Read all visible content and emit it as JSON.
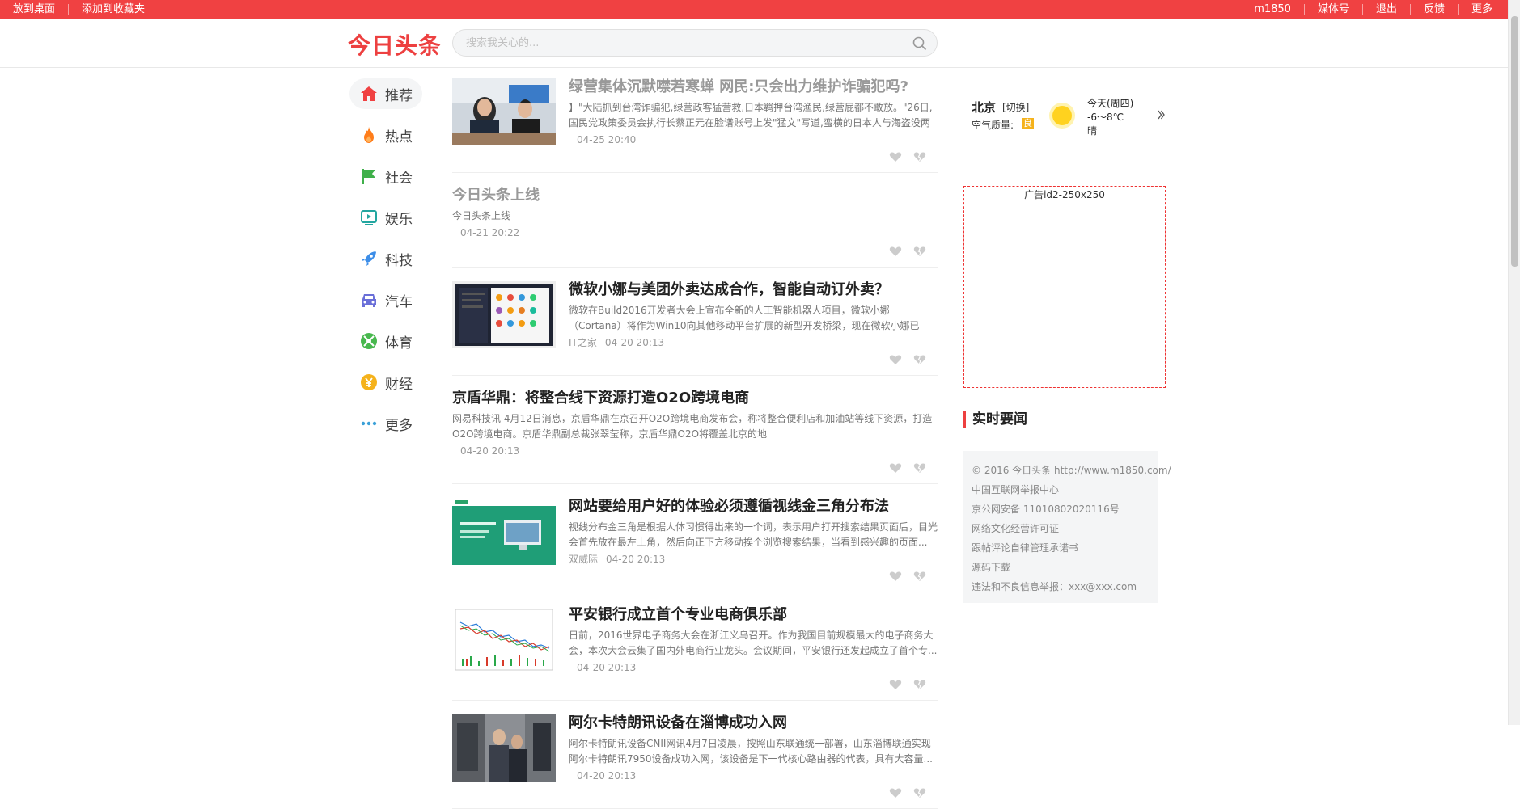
{
  "topbar": {
    "left": [
      "放到桌面",
      "添加到收藏夹"
    ],
    "right": [
      "m1850",
      "媒体号",
      "退出",
      "反馈",
      "更多"
    ]
  },
  "header": {
    "logo": "今日头条",
    "search_placeholder": "搜索我关心的..."
  },
  "nav": [
    {
      "label": "推荐",
      "icon": "home-icon",
      "color": "#f04142"
    },
    {
      "label": "热点",
      "icon": "fire-icon",
      "color": "#ff7d1a"
    },
    {
      "label": "社会",
      "icon": "flag-icon",
      "color": "#3fb04a"
    },
    {
      "label": "娱乐",
      "icon": "play-icon",
      "color": "#23a6a0"
    },
    {
      "label": "科技",
      "icon": "rocket-icon",
      "color": "#3d8ee8"
    },
    {
      "label": "汽车",
      "icon": "car-icon",
      "color": "#6a6fd8"
    },
    {
      "label": "体育",
      "icon": "sport-icon",
      "color": "#48b84e"
    },
    {
      "label": "财经",
      "icon": "money-icon",
      "color": "#f5b21b"
    },
    {
      "label": "更多",
      "icon": "more-icon",
      "color": "#3aa0d8"
    }
  ],
  "feed": [
    {
      "title": "绿营集体沉默噤若寒蝉 网民:只会出力维护诈骗犯吗?",
      "abstract": "】\"大陆抓到台湾诈骗犯,绿营政客猛营救,日本羁押台湾渔民,绿营屁都不敢放。\"26日,国民党政策委员会执行长蔡正元在脸谱账号上发\"猛文\"写道,蛮横的日本人与海盗没两样...",
      "source": "",
      "time": "04-25 20:40",
      "thumb": "meeting",
      "gray": true
    },
    {
      "title": "今日头条上线",
      "abstract": "今日头条上线",
      "source": "",
      "time": "04-21 20:22",
      "thumb": "",
      "gray": true
    },
    {
      "title": "微软小娜与美团外卖达成合作，智能自动订外卖？",
      "abstract": "微软在Build2016开发者大会上宣布全新的人工智能机器人项目，微软小娜（Cortana）将作为Win10向其他移动平台扩展的新型开发桥梁，现在微软小娜已经...",
      "source": "IT之家",
      "time": "04-20 20:13",
      "thumb": "app",
      "gray": false
    },
    {
      "title": "京盾华鼎：将整合线下资源打造O2O跨境电商",
      "abstract": "网易科技讯 4月12日消息，京盾华鼎在京召开O2O跨境电商发布会，称将整合便利店和加油站等线下资源，打造O2O跨境电商。京盾华鼎副总裁张翠莹称，京盾华鼎O2O将覆盖北京的地",
      "source": "",
      "time": "04-20 20:13",
      "thumb": "",
      "gray": false
    },
    {
      "title": "网站要给用户好的体验必须遵循视线金三角分布法",
      "abstract": "视线分布金三角是根据人体习惯得出来的一个词，表示用户打开搜索结果页面后，目光会首先放在最左上角，然后向正下方移动挨个浏览搜索结果，当看到感兴趣的页面...",
      "source": "双威际",
      "time": "04-20 20:13",
      "thumb": "web",
      "gray": false
    },
    {
      "title": "平安银行成立首个专业电商俱乐部",
      "abstract": "日前，2016世界电子商务大会在浙江义乌召开。作为我国目前规模最大的电子商务大会，本次大会云集了国内外电商行业龙头。会议期间，平安银行还发起成立了首个专...",
      "source": "",
      "time": "04-20 20:13",
      "thumb": "chart",
      "gray": false
    },
    {
      "title": "阿尔卡特朗讯设备在淄博成功入网",
      "abstract": "阿尔卡特朗讯设备CNII网讯4月7日凌晨，按照山东联通统一部署，山东淄博联通实现阿尔卡特朗讯7950设备成功入网，该设备是下一代核心路由器的代表，具有大容量...",
      "source": "",
      "time": "04-20 20:13",
      "thumb": "room",
      "gray": false
    }
  ],
  "weather": {
    "city": "北京",
    "switch_label": "[切换]",
    "aqi_label": "空气质量:",
    "aqi_value": "良",
    "day": "今天(周四)",
    "temp": "-6～8℃",
    "desc": "晴"
  },
  "ad": {
    "label": "广告id2-250x250"
  },
  "hot_title": "实时要闻",
  "footer": [
    "© 2016 今日头条 http://www.m1850.com/",
    "中国互联网举报中心",
    "京公网安备 11010802020116号",
    "网络文化经营许可证",
    "跟帖评论自律管理承诺书",
    "源码下载",
    "违法和不良信息举报：xxx@xxx.com"
  ]
}
